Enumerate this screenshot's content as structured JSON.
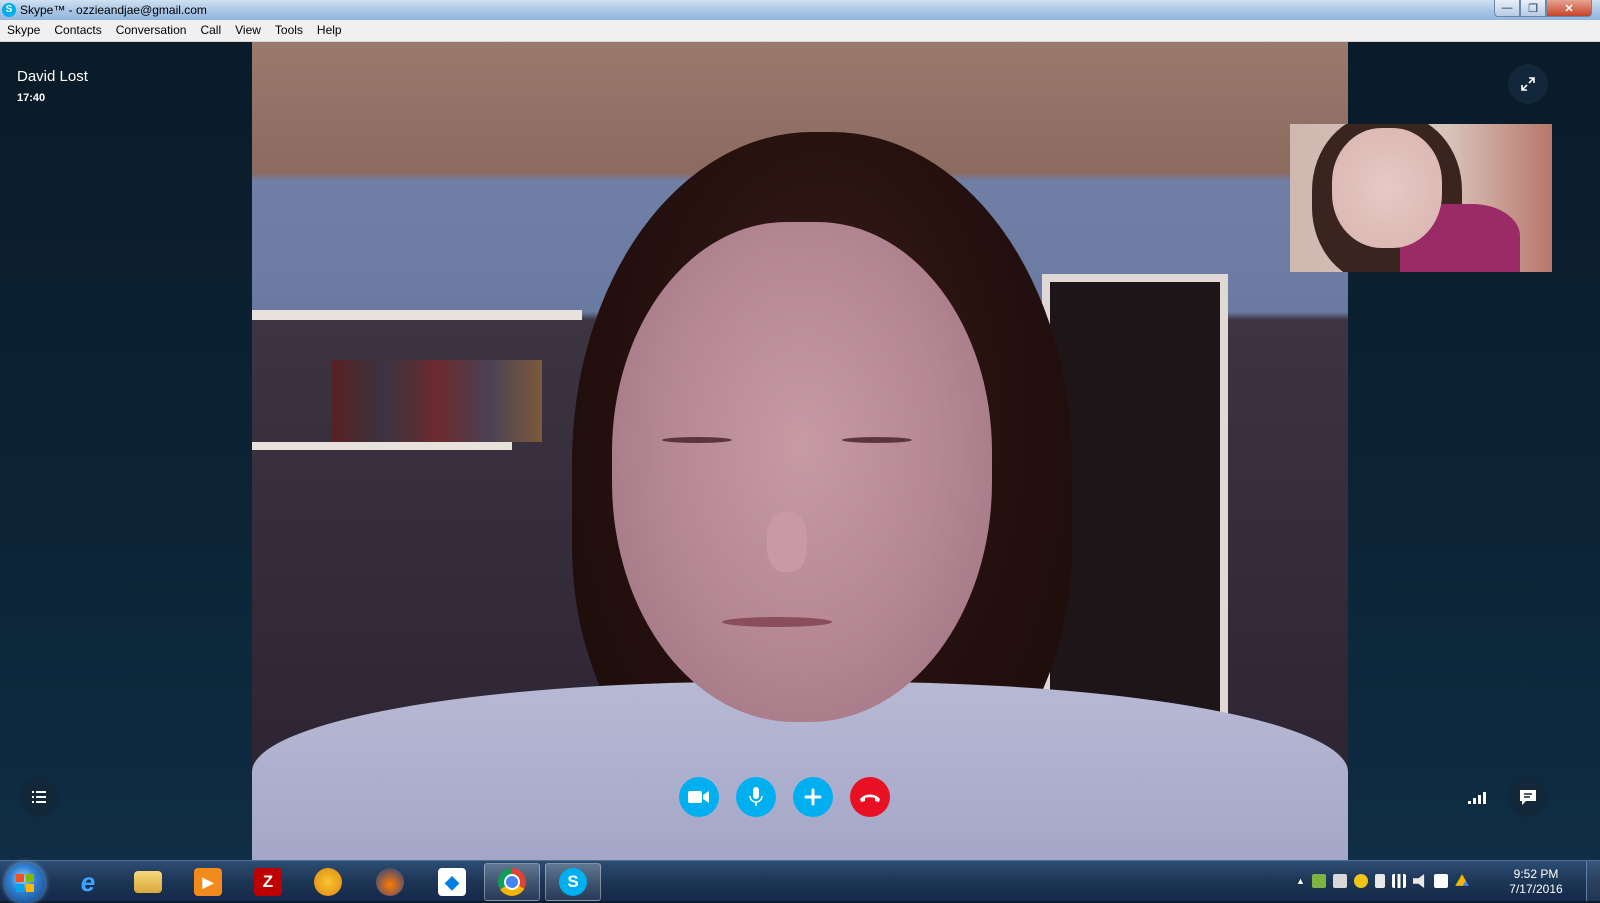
{
  "window": {
    "title": "Skype™ - ozzieandjae@gmail.com",
    "app_icon_letter": "S",
    "minimize_glyph": "—",
    "restore_glyph": "❐",
    "close_glyph": "✕"
  },
  "menu": {
    "items": [
      "Skype",
      "Contacts",
      "Conversation",
      "Call",
      "View",
      "Tools",
      "Help"
    ]
  },
  "call": {
    "contact_name": "David Lost",
    "duration": "17:40",
    "controls": [
      {
        "name": "video",
        "icon": "video-camera-icon",
        "color": "#00aff0"
      },
      {
        "name": "mute",
        "icon": "microphone-icon",
        "color": "#00aff0"
      },
      {
        "name": "add",
        "icon": "plus-icon",
        "color": "#00aff0"
      },
      {
        "name": "hangup",
        "icon": "hang-up-icon",
        "color": "#e81123"
      }
    ],
    "left_tool_icon": "list-icon",
    "right_tool_icons": [
      "signal-strength-icon",
      "chat-bubble-icon"
    ],
    "top_right_icon": "fullscreen-icon"
  },
  "taskbar": {
    "apps": [
      {
        "name": "internet-explorer",
        "icon": "ie-icon"
      },
      {
        "name": "file-explorer",
        "icon": "folder-icon"
      },
      {
        "name": "media-player",
        "icon": "media-player-icon"
      },
      {
        "name": "filezilla",
        "icon": "filezilla-icon",
        "glyph": "Z"
      },
      {
        "name": "fl-studio",
        "icon": "fruity-icon"
      },
      {
        "name": "audacity",
        "icon": "audacity-icon"
      },
      {
        "name": "dropbox",
        "icon": "dropbox-icon"
      },
      {
        "name": "chrome",
        "icon": "chrome-icon"
      },
      {
        "name": "skype",
        "icon": "skype-icon",
        "glyph": "S"
      }
    ],
    "clock": {
      "time": "9:52 PM",
      "date": "7/17/2016"
    }
  },
  "colors": {
    "skype_blue": "#00aff0",
    "hangup_red": "#e81123",
    "panel_bg": "#0b1f30"
  }
}
